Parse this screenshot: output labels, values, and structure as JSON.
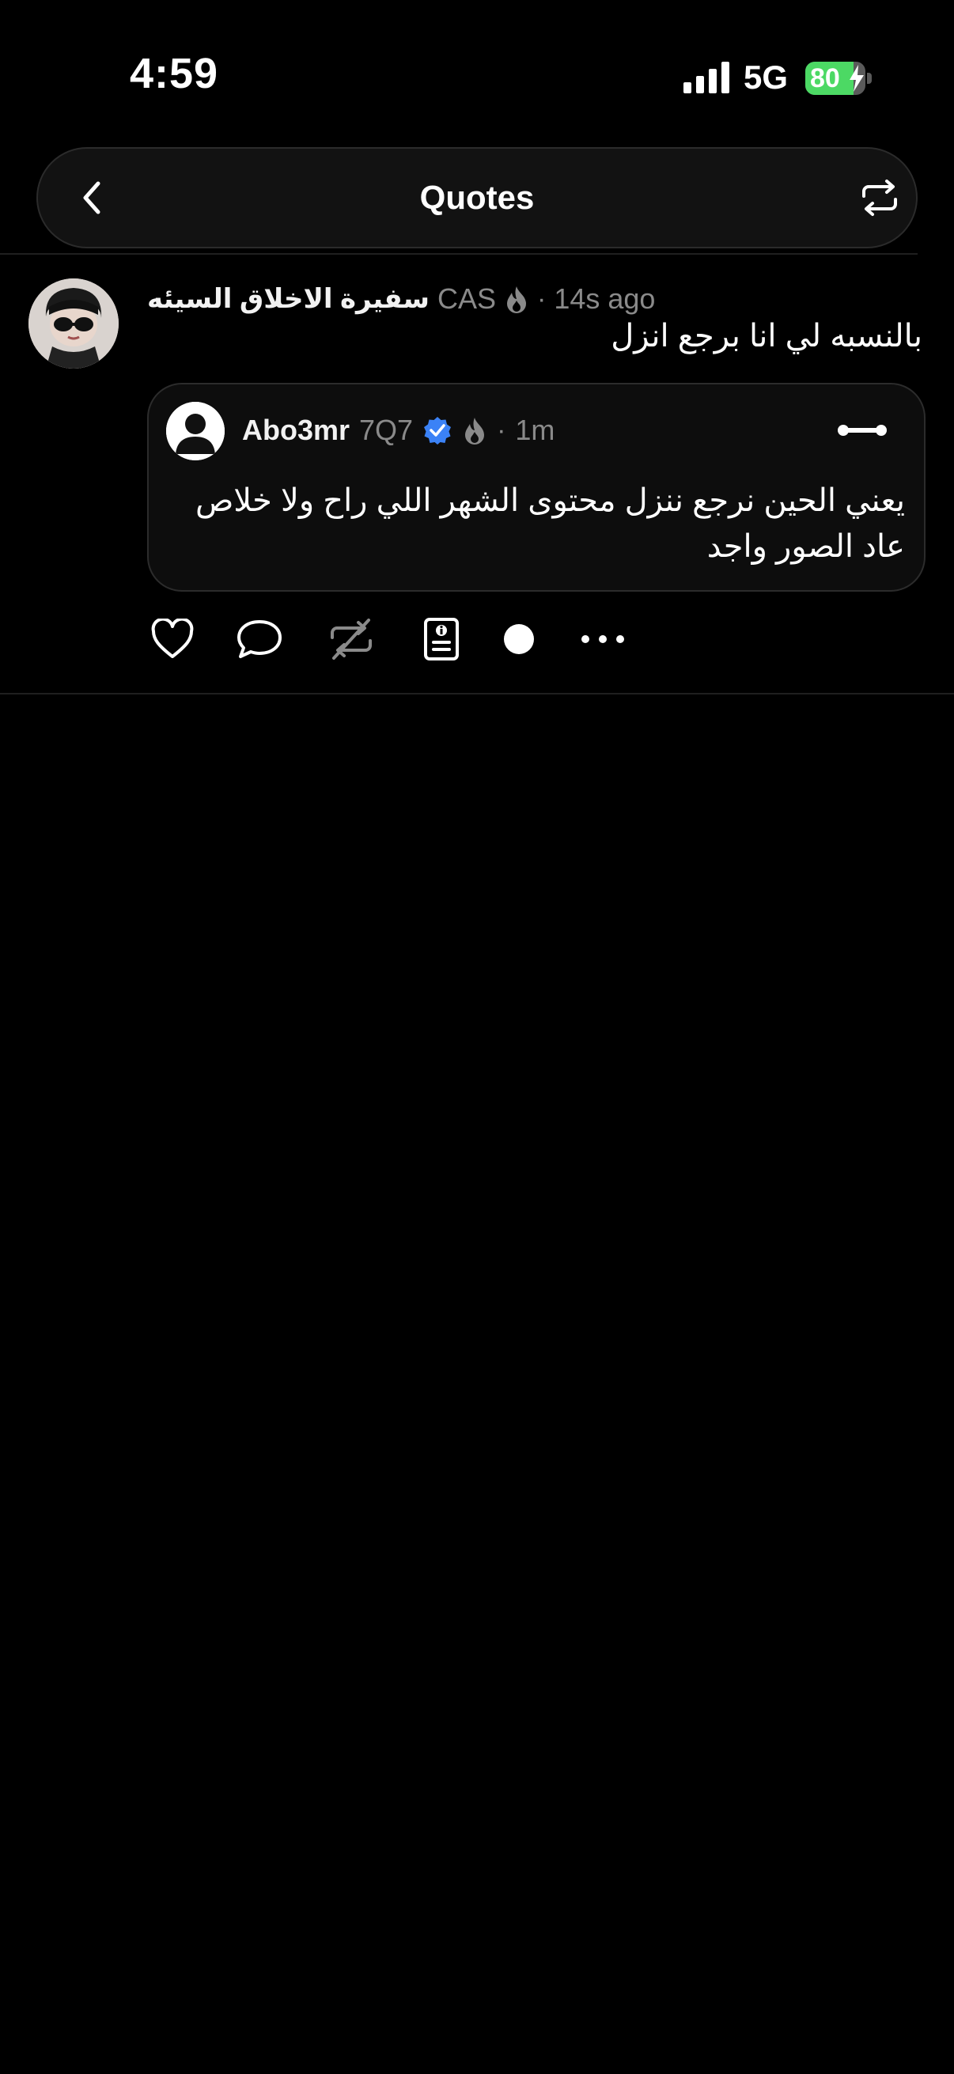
{
  "status_bar": {
    "time": "4:59",
    "network": "5G",
    "battery_percent": "80",
    "battery_level": 0.8
  },
  "header": {
    "title": "Quotes",
    "back_icon": "chevron-left-icon",
    "right_icon": "repost-icon"
  },
  "post": {
    "author_name": "سفيرة الاخلاق السيئه",
    "author_tag": "CAS",
    "separator": "·",
    "time": "14s ago",
    "text": "بالنسبه لي انا برجع انزل",
    "quote": {
      "author_name": "Abo3mr",
      "author_tag": "7Q7",
      "separator": "·",
      "time": "1m",
      "text": "يعني الحين نرجع ننزل محتوى الشهر اللي راح ولا خلاص عاد الصور واجد"
    },
    "actions": [
      "heart-icon",
      "comment-icon",
      "repost-disabled-icon",
      "info-card-icon",
      "dot-icon",
      "more-icon"
    ]
  },
  "colors": {
    "background": "#000000",
    "muted": "#8a8a8a",
    "verified": "#3b82f6",
    "battery": "#4cd964"
  }
}
